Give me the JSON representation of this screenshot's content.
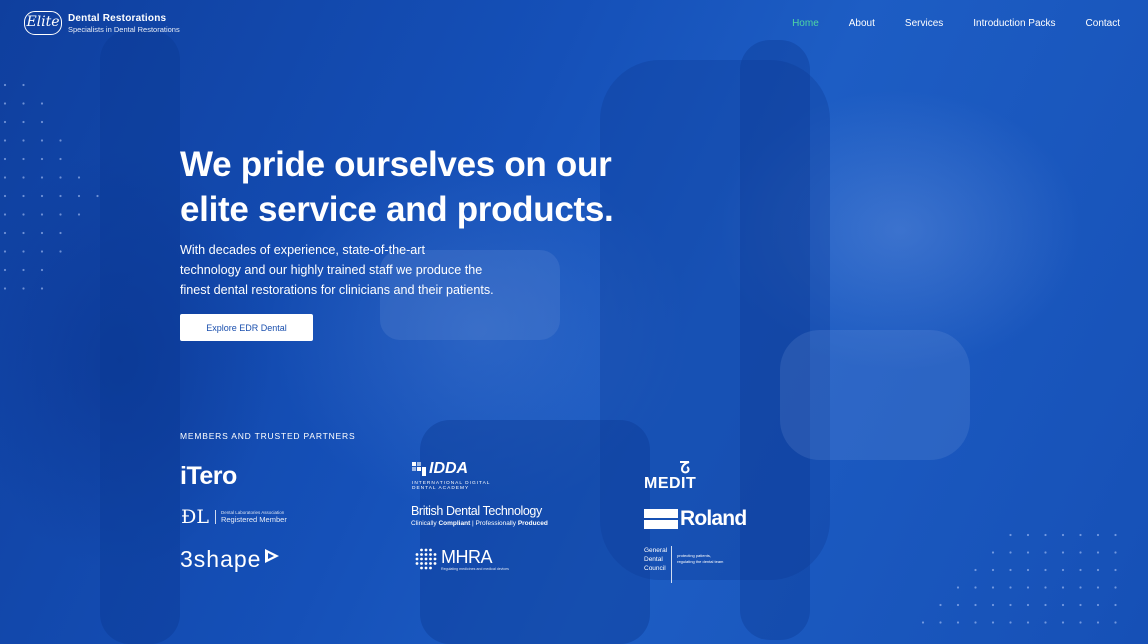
{
  "brand": {
    "mark": "Elite",
    "name": "Dental Restorations",
    "tagline": "Specialists in Dental Restorations"
  },
  "nav": [
    {
      "label": "Home",
      "active": true
    },
    {
      "label": "About",
      "active": false
    },
    {
      "label": "Services",
      "active": false
    },
    {
      "label": "Introduction Packs",
      "active": false
    },
    {
      "label": "Contact",
      "active": false
    }
  ],
  "hero": {
    "headline_line1": "We pride ourselves on our",
    "headline_line2": "elite service and products.",
    "lead_line1": "With decades of experience, state-of-the-art",
    "lead_line2": "technology and our highly trained staff we produce the",
    "lead_line3": "finest dental restorations for clinicians and their patients.",
    "cta_label": "Explore EDR Dental"
  },
  "partners": {
    "title": "MEMBERS AND TRUSTED PARTNERS",
    "itero": "iTero",
    "dla_small": "Dental Laboratories Association",
    "dla_member": "Registered Member",
    "threeshape": "3shape",
    "idda": "IDDA",
    "idda_sub1": "INTERNATIONAL DIGITAL",
    "idda_sub2": "DENTAL ACADEMY",
    "bdt_name": "British Dental Technology",
    "bdt_sub1": "Clinically ",
    "bdt_sub2": "Compliant",
    "bdt_sub3": " | Professionally ",
    "bdt_sub4": "Produced",
    "mhra": "MHRA",
    "mhra_sub": "Regulating medicines and medical devices",
    "medit": "MEDIT",
    "roland": "Roland",
    "gdc_1": "General",
    "gdc_2": "Dental",
    "gdc_3": "Council",
    "gdc_tag1": "protecting patients,",
    "gdc_tag2": "regulating the dental team"
  },
  "colors": {
    "accent_active": "#4fd6a3",
    "bg": "#1550b8",
    "cta_text": "#1a4fae"
  }
}
